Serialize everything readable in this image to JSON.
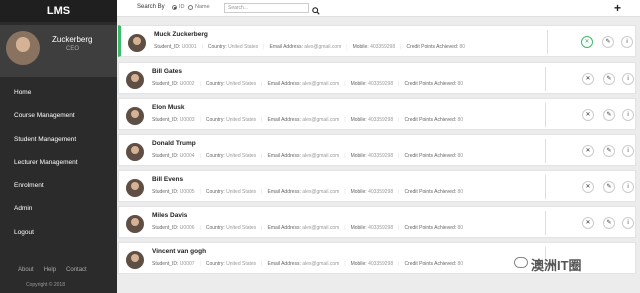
{
  "app": {
    "title": "LMS"
  },
  "profile": {
    "name": "Zuckerberg",
    "role": "CEO"
  },
  "nav": [
    {
      "label": "Home"
    },
    {
      "label": "Course Management"
    },
    {
      "label": "Student Management"
    },
    {
      "label": "Lecturer Management"
    },
    {
      "label": "Enrolment"
    },
    {
      "label": "Admin"
    },
    {
      "label": "Logout"
    }
  ],
  "footer": {
    "about": "About",
    "help": "Help",
    "contact": "Contact",
    "copyright": "Copyright © 2018"
  },
  "search": {
    "label": "Search By",
    "option1": "ID",
    "option2": "Name",
    "placeholder": "Search..."
  },
  "labels": {
    "student_id": "Student_ID:",
    "country": "Country:",
    "email": "Email Address:",
    "mobile": "Mobile:",
    "credit": "Credit Points Achieved:"
  },
  "students": [
    {
      "name": "Muck Zuckerberg",
      "id": "U0001",
      "country": "United States",
      "email": "alex@gmail.com",
      "mobile": "403359298",
      "credits": "80"
    },
    {
      "name": "Bill Gates",
      "id": "U0002",
      "country": "United States",
      "email": "alex@gmail.com",
      "mobile": "403359298",
      "credits": "80"
    },
    {
      "name": "Elon Musk",
      "id": "U0003",
      "country": "United States",
      "email": "alex@gmail.com",
      "mobile": "403359298",
      "credits": "80"
    },
    {
      "name": "Donald Trump",
      "id": "U0004",
      "country": "United States",
      "email": "alex@gmail.com",
      "mobile": "403359298",
      "credits": "80"
    },
    {
      "name": "Bill Evens",
      "id": "U0005",
      "country": "United States",
      "email": "alex@gmail.com",
      "mobile": "403359298",
      "credits": "80"
    },
    {
      "name": "Miles Davis",
      "id": "U0006",
      "country": "United States",
      "email": "alex@gmail.com",
      "mobile": "403359298",
      "credits": "80"
    },
    {
      "name": "Vincent van gogh",
      "id": "U0007",
      "country": "United States",
      "email": "alex@gmail.com",
      "mobile": "403359298",
      "credits": "80"
    }
  ],
  "watermark": "澳洲IT圈",
  "colors": {
    "sidebar": "#2b2b2b",
    "active": "#3fba6a"
  }
}
